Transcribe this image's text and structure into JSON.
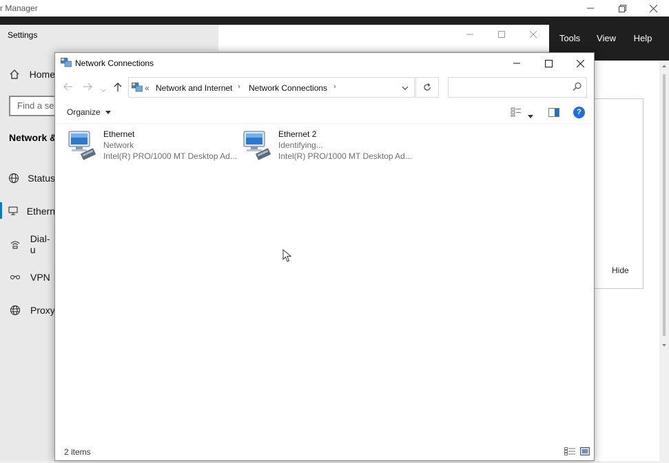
{
  "server_manager": {
    "title": "r Manager",
    "menu": [
      "Tools",
      "View",
      "Help"
    ]
  },
  "settings": {
    "title": "Settings",
    "home_label": "Home",
    "search_placeholder": "Find a se",
    "section_heading": "Network &",
    "nav_items": [
      {
        "label": "Status",
        "icon": "globe-icon"
      },
      {
        "label": "Ethern",
        "icon": "ethernet-icon"
      },
      {
        "label": "Dial-u",
        "icon": "dialup-icon"
      },
      {
        "label": "VPN",
        "icon": "vpn-icon"
      },
      {
        "label": "Proxy",
        "icon": "proxy-globe-icon"
      }
    ],
    "hide_label": "Hide"
  },
  "explorer": {
    "title": "Network Connections",
    "breadcrumb": {
      "overflow": "«",
      "items": [
        "Network and Internet",
        "Network Connections"
      ]
    },
    "search_placeholder": "",
    "organize_label": "Organize",
    "connections": [
      {
        "name": "Ethernet",
        "status": "Network",
        "adapter": "Intel(R) PRO/1000 MT Desktop Ad..."
      },
      {
        "name": "Ethernet 2",
        "status": "Identifying...",
        "adapter": "Intel(R) PRO/1000 MT Desktop Ad..."
      }
    ],
    "status_text": "2 items",
    "help_glyph": "?"
  },
  "colors": {
    "accent": "#0078d4",
    "menubar": "#1f1f1f",
    "help_blue": "#1e6fd9"
  }
}
